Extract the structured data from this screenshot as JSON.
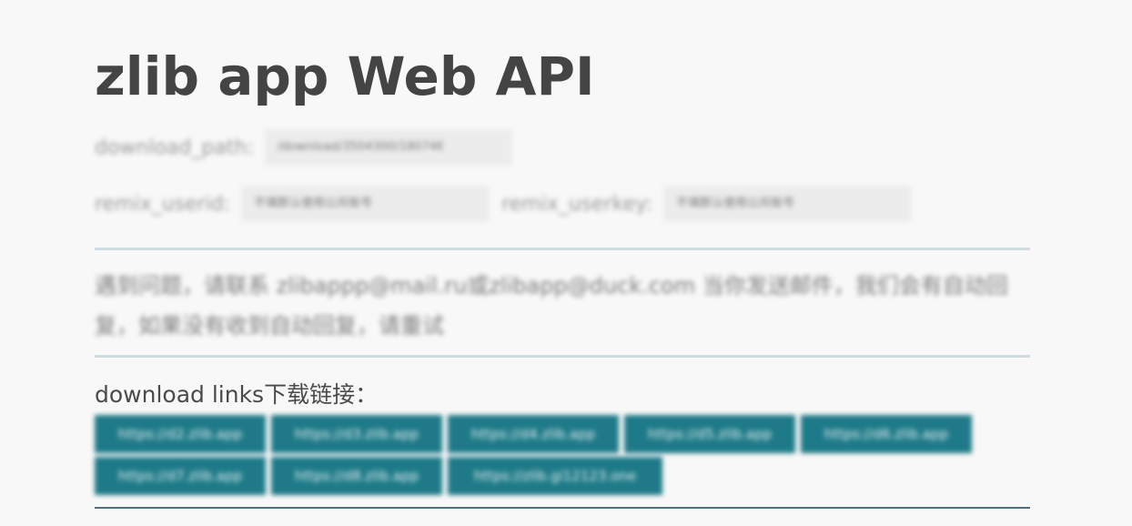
{
  "page": {
    "title": "zlib app Web API"
  },
  "settings": {
    "download_path_label": "download_path:",
    "download_path_value": "/download/3504300/18074€",
    "remix_userid_label": "remix_userid:",
    "remix_userid_placeholder": "不填默认使用公共账号",
    "remix_userkey_label": "remix_userkey:",
    "remix_userkey_placeholder": "不填默认使用公共账号"
  },
  "notice": {
    "text": "遇到问题，请联系 zlibappp@mail.ru或zlibapp@duck.com 当你发送邮件，我们会有自动回复，如果没有收到自动回复，请重试"
  },
  "downloads": {
    "title": "download links下载链接：",
    "links": [
      "https://d2.zlib.app",
      "https://d3.zlib.app",
      "https://d4.zlib.app",
      "https://d5.zlib.app",
      "https://d6.zlib.app",
      "https://d7.zlib.app",
      "https://d8.zlib.app",
      "https://zlib.gi12123.one"
    ]
  },
  "colors": {
    "background": "#f8f8f8",
    "link_button": "#1e7a88",
    "divider": "#cfdde2"
  }
}
